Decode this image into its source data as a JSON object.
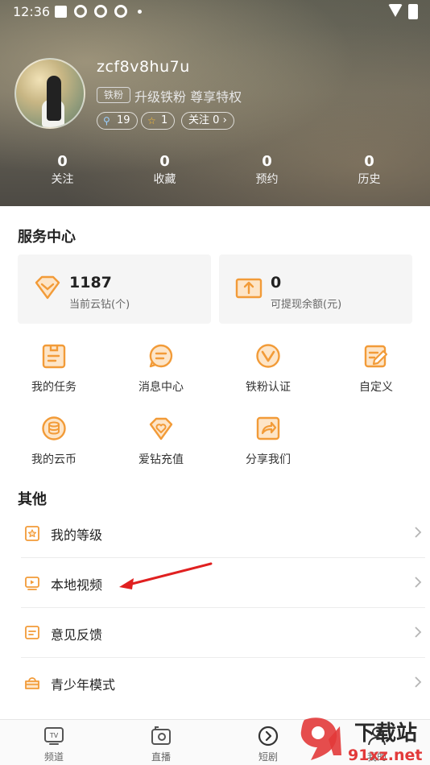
{
  "status_bar": {
    "time": "12:36"
  },
  "profile": {
    "username": "zcf8v8hu7u",
    "fan_badge": "铁粉",
    "upgrade_text": "升级铁粉 尊享特权",
    "chips": {
      "fans": "19",
      "stars": "1",
      "follow_label": "关注",
      "follow_count": "0"
    }
  },
  "stats": [
    {
      "value": "0",
      "label": "关注"
    },
    {
      "value": "0",
      "label": "收藏"
    },
    {
      "value": "0",
      "label": "预约"
    },
    {
      "value": "0",
      "label": "历史"
    }
  ],
  "service_center": {
    "title": "服务中心",
    "cards": [
      {
        "value": "1187",
        "label": "当前云钻(个)",
        "icon": "diamond-icon"
      },
      {
        "value": "0",
        "label": "可提现余额(元)",
        "icon": "withdraw-icon"
      }
    ],
    "grid": [
      {
        "label": "我的任务",
        "icon": "task-icon"
      },
      {
        "label": "消息中心",
        "icon": "message-icon"
      },
      {
        "label": "铁粉认证",
        "icon": "verify-icon"
      },
      {
        "label": "自定义",
        "icon": "customize-icon"
      },
      {
        "label": "我的云币",
        "icon": "coin-icon"
      },
      {
        "label": "爱钻充值",
        "icon": "recharge-icon"
      },
      {
        "label": "分享我们",
        "icon": "share-icon"
      }
    ]
  },
  "other": {
    "title": "其他",
    "items": [
      {
        "label": "我的等级",
        "icon": "level-icon"
      },
      {
        "label": "本地视频",
        "icon": "video-icon"
      },
      {
        "label": "意见反馈",
        "icon": "feedback-icon"
      },
      {
        "label": "青少年模式",
        "icon": "teen-mode-icon"
      }
    ]
  },
  "bottom_nav": [
    {
      "label": "频道",
      "icon": "tv-icon"
    },
    {
      "label": "直播",
      "icon": "live-icon"
    },
    {
      "label": "短剧",
      "icon": "play-circle-icon"
    },
    {
      "label": "我的",
      "icon": "user-icon"
    }
  ],
  "watermark": {
    "main": "下载站",
    "sub": "91xz.net"
  },
  "colors": {
    "accent": "#f29b38",
    "text": "#222222"
  }
}
